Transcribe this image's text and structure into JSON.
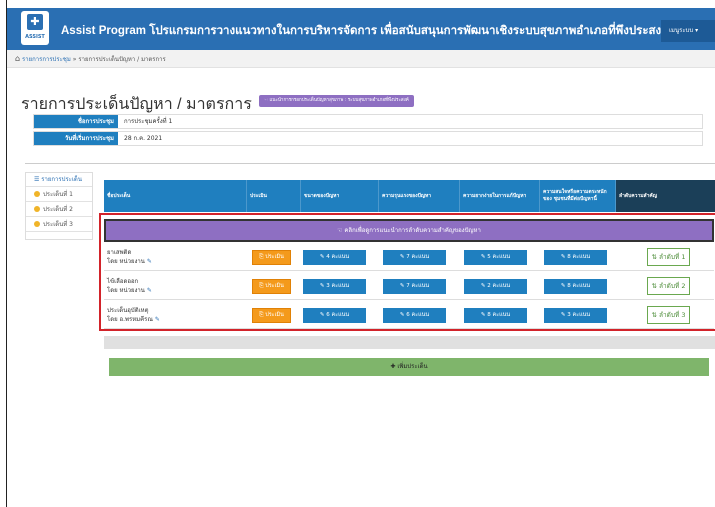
{
  "header": {
    "logo_text": "ASSIST",
    "app_title": "Assist Program โปรแกรมการวางแนวทางในการบริหารจัดการ เพื่อสนับสนุนการพัฒนาเชิงระบบสุขภาพอำเภอที่พึงประสงค์ เขต",
    "user_menu": "เมนูระบบ ▾"
  },
  "breadcrumb": {
    "home_icon": "home-icon",
    "first": "รายการการประชุม",
    "separator": "»",
    "current": "รายการประเด็นปัญหา / มาตรการ"
  },
  "page": {
    "title": "รายการประเด็นปัญหา / มาตรการ",
    "badge": "☜ แนะนำการกรอกประเด็นปัญหาสุขภาพ : ระบบสุขภาพอำเภอที่พึงประสงค์"
  },
  "meeting_info": [
    {
      "label": "ชื่อการประชุม",
      "value": "การประชุมครั้งที่ 1"
    },
    {
      "label": "วันที่เริ่มการประชุม",
      "value": "28 ก.ค. 2021"
    }
  ],
  "sidebar": {
    "header": "รายการประเด็น",
    "items": [
      {
        "label": "ประเด็นที่ 1"
      },
      {
        "label": "ประเด็นที่ 2"
      },
      {
        "label": "ประเด็นที่ 3"
      }
    ]
  },
  "table": {
    "columns": [
      "ชื่อประเด็น",
      "ประเมิน",
      "ขนาดของปัญหา",
      "ความรุนแรงของปัญหา",
      "ความยากง่ายในการแก้ปัญหา",
      "ความสนใจหรือความตระหนักของ ชุมชนที่มีต่อปัญหานี้",
      "ลำดับความสำคัญ"
    ],
    "hint_band": "☜ คลิกเพื่อดูการแนะนำการลำดับความสำคัญของปัญหา",
    "rows": [
      {
        "title": "ยาเสพติด",
        "owner": "โดย หน่วยงาน",
        "detail": "ประเมิน",
        "scores": [
          "4 คะแนน",
          "7 คะแนน",
          "5 คะแนน",
          "8 คะแนน"
        ],
        "rank": "ลำดับที่ 1"
      },
      {
        "title": "ไข้เลือดออก",
        "owner": "โดย หน่วยงาน",
        "detail": "ประเมิน",
        "scores": [
          "3 คะแนน",
          "7 คะแนน",
          "2 คะแนน",
          "8 คะแนน"
        ],
        "rank": "ลำดับที่ 2"
      },
      {
        "title": "ประเด็นอุบัติเหตุ",
        "owner": "โดย อ.พรหมคีรณ",
        "detail": "ประเมิน",
        "scores": [
          "6 คะแนน",
          "6 คะแนน",
          "8 คะแนน",
          "3 คะแนน"
        ],
        "rank": "ลำดับที่ 3"
      }
    ]
  },
  "add_button": "✚ เพิ่มประเด็น",
  "colors": {
    "primary": "#1f7fbf",
    "header_bg": "#2a6fb3",
    "purple": "#8e6fc2",
    "orange": "#f49a1c",
    "green": "#7fb56b",
    "highlight_red": "#d2232a"
  }
}
